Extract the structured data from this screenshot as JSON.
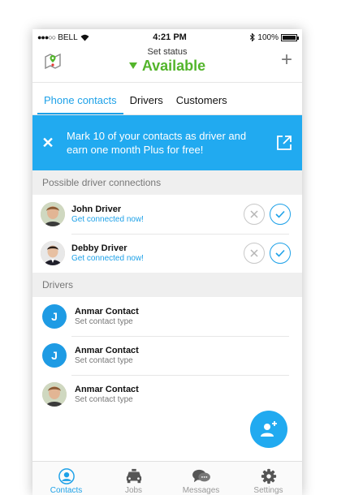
{
  "statusbar": {
    "carrier": "BELL",
    "time": "4:21 PM",
    "battery": "100%"
  },
  "header": {
    "set_status_label": "Set status",
    "status_value": "Available"
  },
  "tabs": [
    {
      "label": "Phone contacts",
      "active": true
    },
    {
      "label": "Drivers",
      "active": false
    },
    {
      "label": "Customers",
      "active": false
    }
  ],
  "banner": {
    "text": "Mark 10 of your contacts as driver and earn one month Plus for free!"
  },
  "sections": {
    "possible": {
      "title": "Possible driver connections",
      "items": [
        {
          "name": "John Driver",
          "subtitle": "Get connected now!"
        },
        {
          "name": "Debby Driver",
          "subtitle": "Get connected now!"
        }
      ]
    },
    "drivers": {
      "title": "Drivers",
      "items": [
        {
          "name": "Anmar Contact",
          "subtitle": "Set contact type",
          "initial": "J"
        },
        {
          "name": "Anmar Contact",
          "subtitle": "Set contact type",
          "initial": "J"
        },
        {
          "name": "Anmar Contact",
          "subtitle": "Set contact type",
          "initial": ""
        }
      ]
    }
  },
  "bottom_nav": [
    {
      "label": "Contacts",
      "icon": "person-icon",
      "active": true
    },
    {
      "label": "Jobs",
      "icon": "taxi-icon",
      "active": false
    },
    {
      "label": "Messages",
      "icon": "chat-icon",
      "active": false
    },
    {
      "label": "Settings",
      "icon": "gear-icon",
      "active": false
    }
  ],
  "colors": {
    "accent": "#21aaf0",
    "available": "#53b52b"
  }
}
